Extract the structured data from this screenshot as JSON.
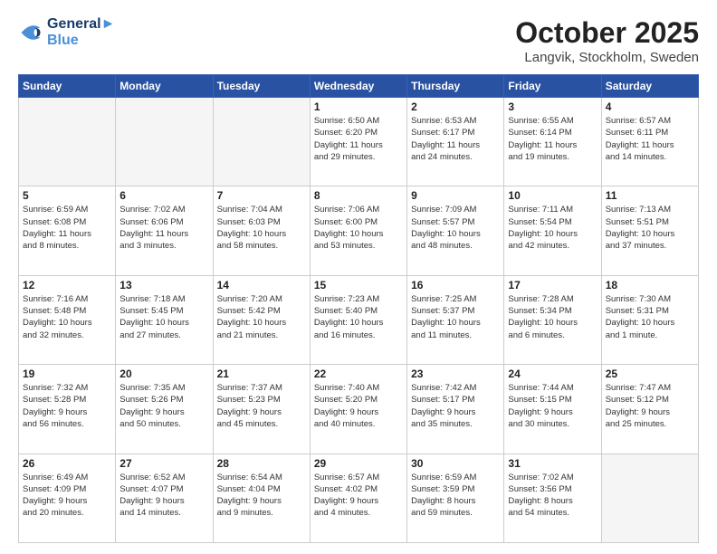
{
  "header": {
    "logo_line1": "General",
    "logo_line2": "Blue",
    "month": "October 2025",
    "location": "Langvik, Stockholm, Sweden"
  },
  "weekdays": [
    "Sunday",
    "Monday",
    "Tuesday",
    "Wednesday",
    "Thursday",
    "Friday",
    "Saturday"
  ],
  "weeks": [
    [
      {
        "day": "",
        "info": ""
      },
      {
        "day": "",
        "info": ""
      },
      {
        "day": "",
        "info": ""
      },
      {
        "day": "1",
        "info": "Sunrise: 6:50 AM\nSunset: 6:20 PM\nDaylight: 11 hours\nand 29 minutes."
      },
      {
        "day": "2",
        "info": "Sunrise: 6:53 AM\nSunset: 6:17 PM\nDaylight: 11 hours\nand 24 minutes."
      },
      {
        "day": "3",
        "info": "Sunrise: 6:55 AM\nSunset: 6:14 PM\nDaylight: 11 hours\nand 19 minutes."
      },
      {
        "day": "4",
        "info": "Sunrise: 6:57 AM\nSunset: 6:11 PM\nDaylight: 11 hours\nand 14 minutes."
      }
    ],
    [
      {
        "day": "5",
        "info": "Sunrise: 6:59 AM\nSunset: 6:08 PM\nDaylight: 11 hours\nand 8 minutes."
      },
      {
        "day": "6",
        "info": "Sunrise: 7:02 AM\nSunset: 6:06 PM\nDaylight: 11 hours\nand 3 minutes."
      },
      {
        "day": "7",
        "info": "Sunrise: 7:04 AM\nSunset: 6:03 PM\nDaylight: 10 hours\nand 58 minutes."
      },
      {
        "day": "8",
        "info": "Sunrise: 7:06 AM\nSunset: 6:00 PM\nDaylight: 10 hours\nand 53 minutes."
      },
      {
        "day": "9",
        "info": "Sunrise: 7:09 AM\nSunset: 5:57 PM\nDaylight: 10 hours\nand 48 minutes."
      },
      {
        "day": "10",
        "info": "Sunrise: 7:11 AM\nSunset: 5:54 PM\nDaylight: 10 hours\nand 42 minutes."
      },
      {
        "day": "11",
        "info": "Sunrise: 7:13 AM\nSunset: 5:51 PM\nDaylight: 10 hours\nand 37 minutes."
      }
    ],
    [
      {
        "day": "12",
        "info": "Sunrise: 7:16 AM\nSunset: 5:48 PM\nDaylight: 10 hours\nand 32 minutes."
      },
      {
        "day": "13",
        "info": "Sunrise: 7:18 AM\nSunset: 5:45 PM\nDaylight: 10 hours\nand 27 minutes."
      },
      {
        "day": "14",
        "info": "Sunrise: 7:20 AM\nSunset: 5:42 PM\nDaylight: 10 hours\nand 21 minutes."
      },
      {
        "day": "15",
        "info": "Sunrise: 7:23 AM\nSunset: 5:40 PM\nDaylight: 10 hours\nand 16 minutes."
      },
      {
        "day": "16",
        "info": "Sunrise: 7:25 AM\nSunset: 5:37 PM\nDaylight: 10 hours\nand 11 minutes."
      },
      {
        "day": "17",
        "info": "Sunrise: 7:28 AM\nSunset: 5:34 PM\nDaylight: 10 hours\nand 6 minutes."
      },
      {
        "day": "18",
        "info": "Sunrise: 7:30 AM\nSunset: 5:31 PM\nDaylight: 10 hours\nand 1 minute."
      }
    ],
    [
      {
        "day": "19",
        "info": "Sunrise: 7:32 AM\nSunset: 5:28 PM\nDaylight: 9 hours\nand 56 minutes."
      },
      {
        "day": "20",
        "info": "Sunrise: 7:35 AM\nSunset: 5:26 PM\nDaylight: 9 hours\nand 50 minutes."
      },
      {
        "day": "21",
        "info": "Sunrise: 7:37 AM\nSunset: 5:23 PM\nDaylight: 9 hours\nand 45 minutes."
      },
      {
        "day": "22",
        "info": "Sunrise: 7:40 AM\nSunset: 5:20 PM\nDaylight: 9 hours\nand 40 minutes."
      },
      {
        "day": "23",
        "info": "Sunrise: 7:42 AM\nSunset: 5:17 PM\nDaylight: 9 hours\nand 35 minutes."
      },
      {
        "day": "24",
        "info": "Sunrise: 7:44 AM\nSunset: 5:15 PM\nDaylight: 9 hours\nand 30 minutes."
      },
      {
        "day": "25",
        "info": "Sunrise: 7:47 AM\nSunset: 5:12 PM\nDaylight: 9 hours\nand 25 minutes."
      }
    ],
    [
      {
        "day": "26",
        "info": "Sunrise: 6:49 AM\nSunset: 4:09 PM\nDaylight: 9 hours\nand 20 minutes."
      },
      {
        "day": "27",
        "info": "Sunrise: 6:52 AM\nSunset: 4:07 PM\nDaylight: 9 hours\nand 14 minutes."
      },
      {
        "day": "28",
        "info": "Sunrise: 6:54 AM\nSunset: 4:04 PM\nDaylight: 9 hours\nand 9 minutes."
      },
      {
        "day": "29",
        "info": "Sunrise: 6:57 AM\nSunset: 4:02 PM\nDaylight: 9 hours\nand 4 minutes."
      },
      {
        "day": "30",
        "info": "Sunrise: 6:59 AM\nSunset: 3:59 PM\nDaylight: 8 hours\nand 59 minutes."
      },
      {
        "day": "31",
        "info": "Sunrise: 7:02 AM\nSunset: 3:56 PM\nDaylight: 8 hours\nand 54 minutes."
      },
      {
        "day": "",
        "info": ""
      }
    ]
  ]
}
